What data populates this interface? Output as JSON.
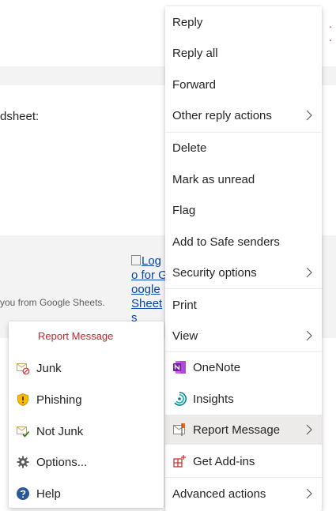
{
  "background": {
    "text_fragment": "dsheet:",
    "footer_fragment": "you from Google Sheets.",
    "logo_alt": "Logo for Google Sheets",
    "dots": ". ."
  },
  "context_menu": {
    "items": [
      {
        "label": "Reply"
      },
      {
        "label": "Reply all"
      },
      {
        "label": "Forward"
      },
      {
        "label": "Other reply actions",
        "submenu": true
      },
      {
        "label": "Delete"
      },
      {
        "label": "Mark as unread"
      },
      {
        "label": "Flag"
      },
      {
        "label": "Add to Safe senders"
      },
      {
        "label": "Security options",
        "submenu": true
      },
      {
        "label": "Print"
      },
      {
        "label": "View",
        "submenu": true
      },
      {
        "label": "OneNote",
        "icon": "onenote-icon"
      },
      {
        "label": "Insights",
        "icon": "insights-icon"
      },
      {
        "label": "Report Message",
        "icon": "report-message-icon",
        "submenu": true,
        "active": true
      },
      {
        "label": "Get Add-ins",
        "icon": "get-addins-icon"
      },
      {
        "label": "Advanced actions",
        "submenu": true
      }
    ]
  },
  "report_submenu": {
    "title": "Report Message",
    "items": [
      {
        "label": "Junk",
        "icon": "junk-icon"
      },
      {
        "label": "Phishing",
        "icon": "phishing-icon"
      },
      {
        "label": "Not Junk",
        "icon": "not-junk-icon"
      },
      {
        "label": "Options...",
        "icon": "gear-icon"
      },
      {
        "label": "Help",
        "icon": "help-icon"
      }
    ]
  },
  "colors": {
    "accent_red": "#c4262e",
    "onenote_purple": "#7719aa",
    "insights_teal": "#038387",
    "help_blue": "#2b579a",
    "hover_gray": "#edebe9"
  }
}
